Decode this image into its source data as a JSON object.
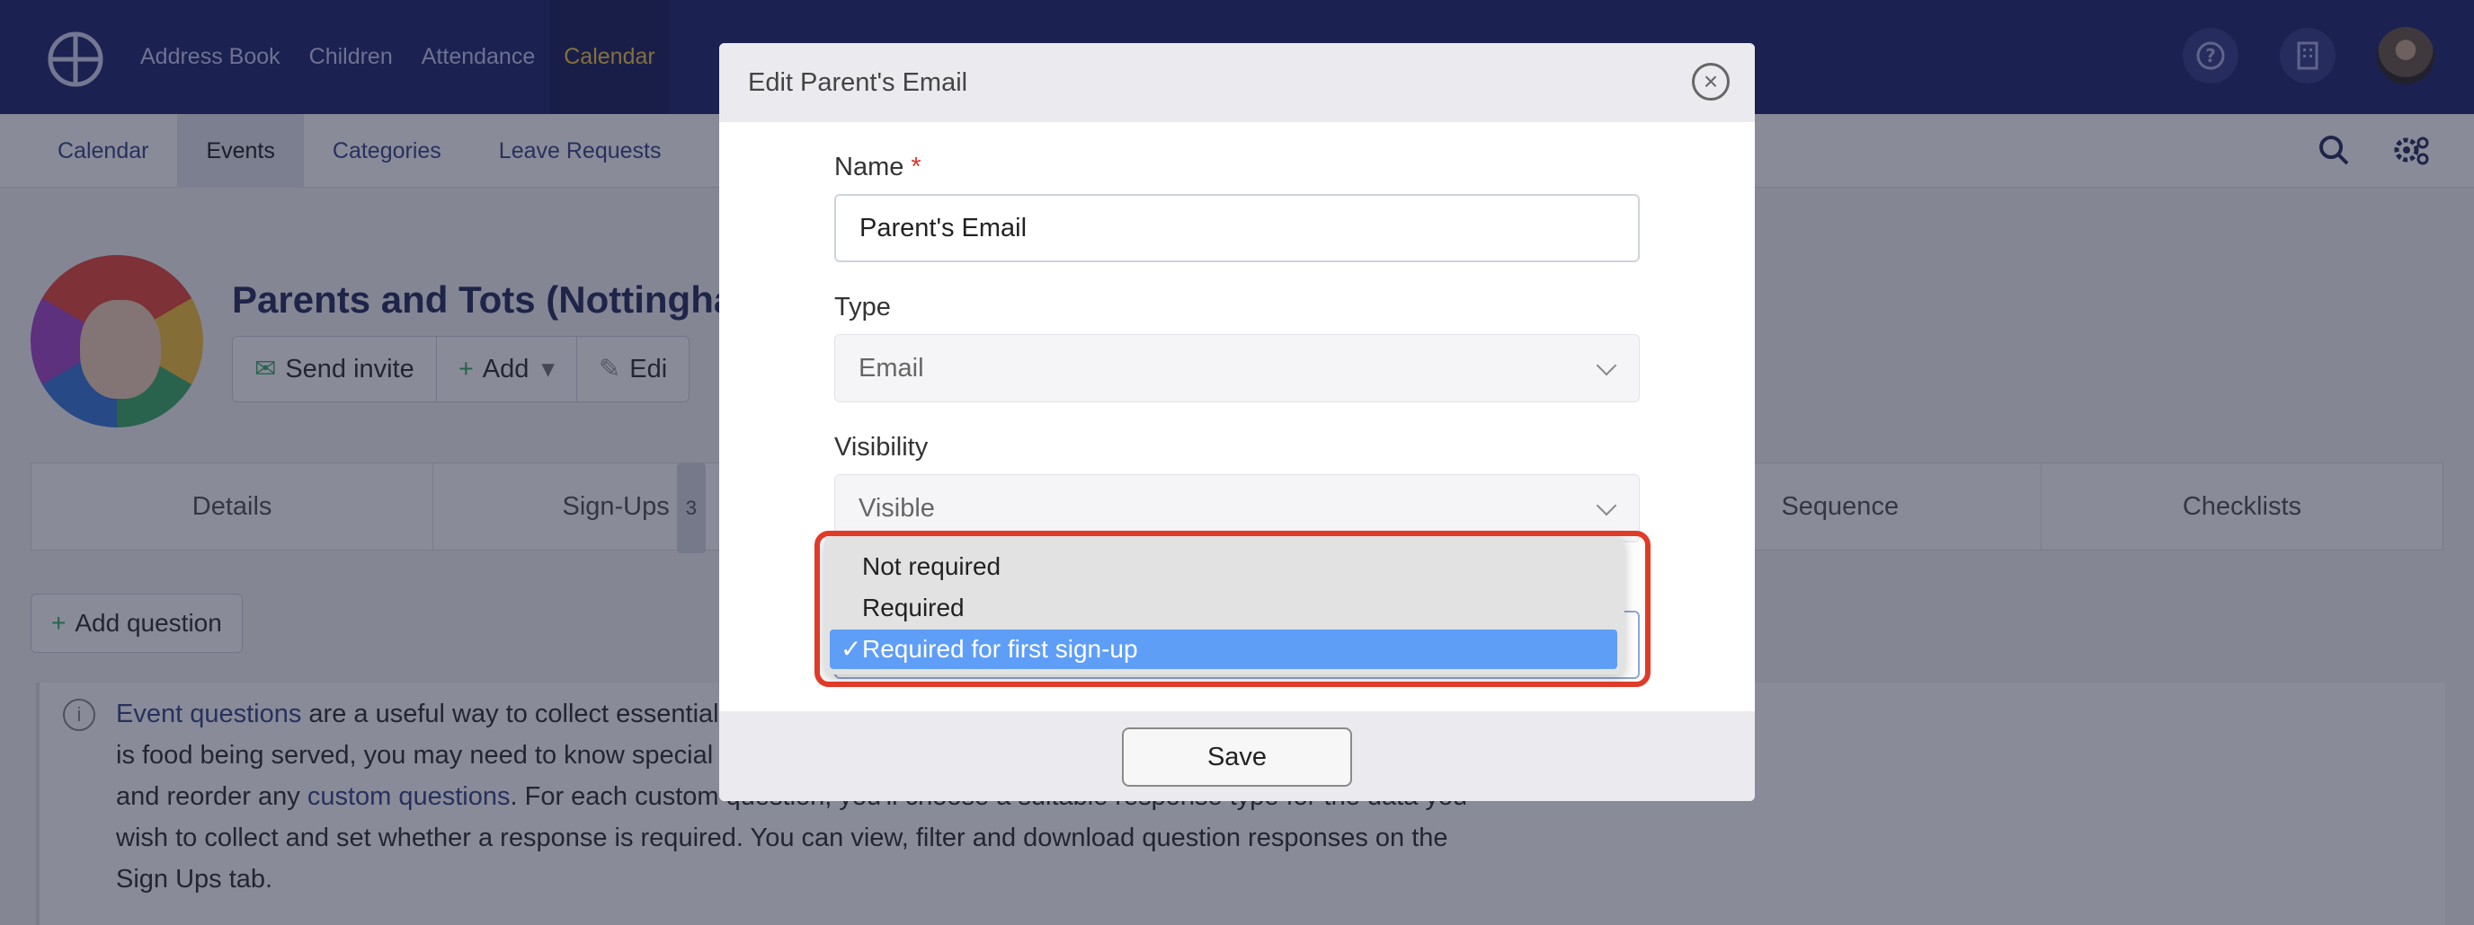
{
  "topbar": {
    "nav": [
      "Address Book",
      "Children",
      "Attendance",
      "Calendar"
    ],
    "active_index": 3
  },
  "subnav": {
    "items": [
      "Calendar",
      "Events",
      "Categories",
      "Leave Requests"
    ],
    "active_index": 1
  },
  "event": {
    "title": "Parents and Tots (Nottingha",
    "actions": {
      "send_invite": "Send invite",
      "add": "Add",
      "edit": "Edi"
    }
  },
  "tabs": {
    "details": "Details",
    "signups": "Sign-Ups",
    "signups_count": "3",
    "sequence": "Sequence",
    "checklists": "Checklists"
  },
  "add_question": "Add question",
  "info": {
    "line1_link": "Event questions",
    "line1_rest": " are a useful way to collect essential",
    "line2": "is food being served, you may need to know special",
    "line3_pre": "and reorder any ",
    "line3_link": "custom questions",
    "line3_rest": ". For each custom question, you'll choose a suitable response type for the data you",
    "line4": "wish to collect and set whether a response is required. You can view, filter and download question responses on the",
    "line5": "Sign Ups tab."
  },
  "modal": {
    "title": "Edit Parent's Email",
    "name_label": "Name",
    "required_mark": "*",
    "name_value": "Parent's Email",
    "type_label": "Type",
    "type_value": "Email",
    "visibility_label": "Visibility",
    "visibility_value": "Visible",
    "save_label": "Save"
  },
  "dropdown": {
    "options": [
      "Not required",
      "Required",
      "Required for first sign-up"
    ],
    "selected_index": 2,
    "check": "✓"
  },
  "colors": {
    "topbar": "#232a6e",
    "active_nav_text": "#f2c94c",
    "selected_option": "#5f9ef7",
    "highlight_ring": "#e03a28",
    "required": "#d9362b"
  }
}
